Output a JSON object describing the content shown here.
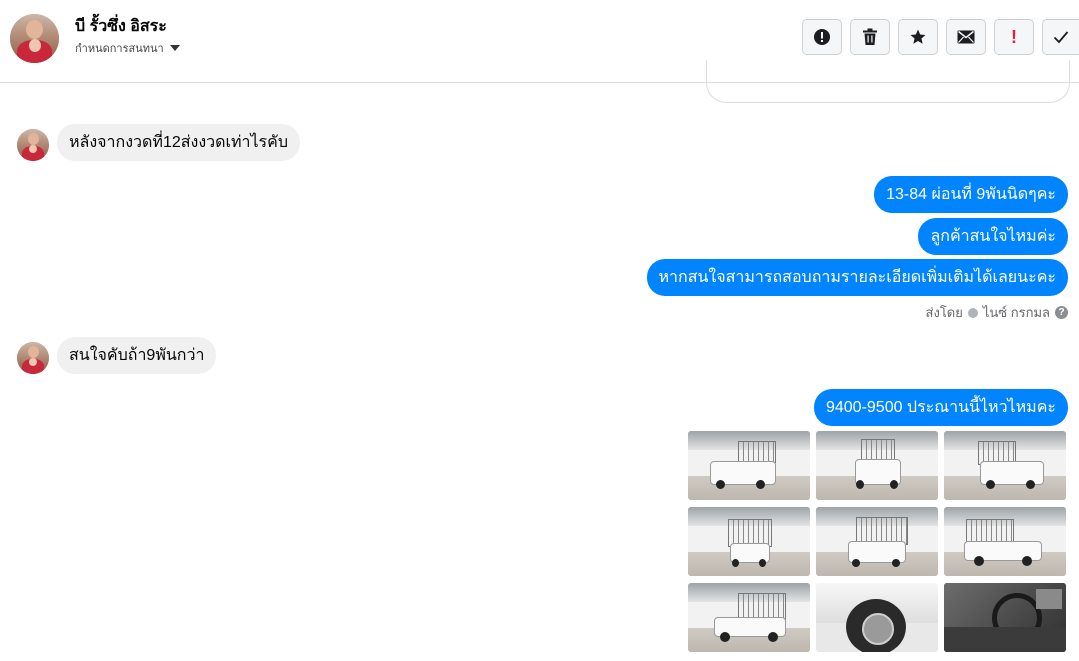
{
  "header": {
    "contact_name": "บี รั้วซึ่ง อิสระ",
    "conversation_settings": "กำหนดการสนทนา",
    "actions": [
      {
        "icon": "alert-circle-icon",
        "label": "!"
      },
      {
        "icon": "trash-icon",
        "label": ""
      },
      {
        "icon": "star-icon",
        "label": ""
      },
      {
        "icon": "envelope-icon",
        "label": ""
      },
      {
        "icon": "exclamation-icon",
        "label": "!"
      },
      {
        "icon": "check-icon",
        "label": ""
      }
    ]
  },
  "messages": [
    {
      "direction": "incoming",
      "text": "หลังจากงวดที่12ส่งงวดเท่าไรคับ"
    },
    {
      "direction": "outgoing",
      "text": "13-84 ผ่อนที่ 9พันนิดๆคะ"
    },
    {
      "direction": "outgoing",
      "text": "ลูกค้าสนใจไหมค่ะ"
    },
    {
      "direction": "outgoing",
      "text": "หากสนใจสามารถสอบถามรายละเอียดเพิ่มเติมได้เลยนะคะ"
    },
    {
      "direction": "incoming",
      "text": "สนใจคับถ้า9พันกว่า"
    },
    {
      "direction": "outgoing",
      "text": "9400-9500 ประณานนี้ไหวไหมคะ"
    }
  ],
  "sent_by": {
    "prefix": "ส่งโดย",
    "name": "ไนซ์ กรกมล",
    "help": "?"
  },
  "photos": {
    "count": 9,
    "rows": 3,
    "columns": 3
  },
  "colors": {
    "outgoing_bubble": "#0084ff",
    "incoming_bubble": "#f0f0f0",
    "exclamation_red": "#e41e3f"
  }
}
